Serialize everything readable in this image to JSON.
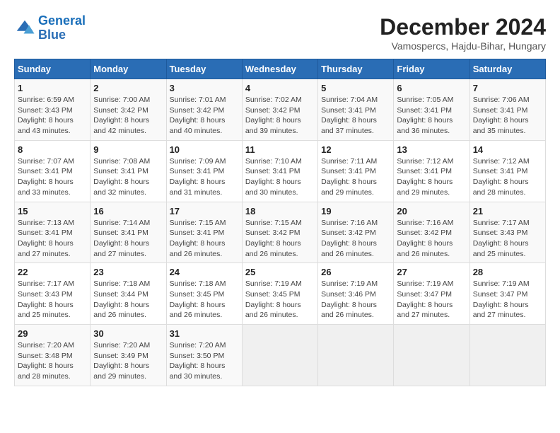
{
  "header": {
    "logo_line1": "General",
    "logo_line2": "Blue",
    "title": "December 2024",
    "subtitle": "Vamospercs, Hajdu-Bihar, Hungary"
  },
  "days_of_week": [
    "Sunday",
    "Monday",
    "Tuesday",
    "Wednesday",
    "Thursday",
    "Friday",
    "Saturday"
  ],
  "weeks": [
    [
      {
        "day": "1",
        "sunrise": "6:59 AM",
        "sunset": "3:43 PM",
        "daylight": "8 hours and 43 minutes."
      },
      {
        "day": "2",
        "sunrise": "7:00 AM",
        "sunset": "3:42 PM",
        "daylight": "8 hours and 42 minutes."
      },
      {
        "day": "3",
        "sunrise": "7:01 AM",
        "sunset": "3:42 PM",
        "daylight": "8 hours and 40 minutes."
      },
      {
        "day": "4",
        "sunrise": "7:02 AM",
        "sunset": "3:42 PM",
        "daylight": "8 hours and 39 minutes."
      },
      {
        "day": "5",
        "sunrise": "7:04 AM",
        "sunset": "3:41 PM",
        "daylight": "8 hours and 37 minutes."
      },
      {
        "day": "6",
        "sunrise": "7:05 AM",
        "sunset": "3:41 PM",
        "daylight": "8 hours and 36 minutes."
      },
      {
        "day": "7",
        "sunrise": "7:06 AM",
        "sunset": "3:41 PM",
        "daylight": "8 hours and 35 minutes."
      }
    ],
    [
      {
        "day": "8",
        "sunrise": "7:07 AM",
        "sunset": "3:41 PM",
        "daylight": "8 hours and 33 minutes."
      },
      {
        "day": "9",
        "sunrise": "7:08 AM",
        "sunset": "3:41 PM",
        "daylight": "8 hours and 32 minutes."
      },
      {
        "day": "10",
        "sunrise": "7:09 AM",
        "sunset": "3:41 PM",
        "daylight": "8 hours and 31 minutes."
      },
      {
        "day": "11",
        "sunrise": "7:10 AM",
        "sunset": "3:41 PM",
        "daylight": "8 hours and 30 minutes."
      },
      {
        "day": "12",
        "sunrise": "7:11 AM",
        "sunset": "3:41 PM",
        "daylight": "8 hours and 29 minutes."
      },
      {
        "day": "13",
        "sunrise": "7:12 AM",
        "sunset": "3:41 PM",
        "daylight": "8 hours and 29 minutes."
      },
      {
        "day": "14",
        "sunrise": "7:12 AM",
        "sunset": "3:41 PM",
        "daylight": "8 hours and 28 minutes."
      }
    ],
    [
      {
        "day": "15",
        "sunrise": "7:13 AM",
        "sunset": "3:41 PM",
        "daylight": "8 hours and 27 minutes."
      },
      {
        "day": "16",
        "sunrise": "7:14 AM",
        "sunset": "3:41 PM",
        "daylight": "8 hours and 27 minutes."
      },
      {
        "day": "17",
        "sunrise": "7:15 AM",
        "sunset": "3:41 PM",
        "daylight": "8 hours and 26 minutes."
      },
      {
        "day": "18",
        "sunrise": "7:15 AM",
        "sunset": "3:42 PM",
        "daylight": "8 hours and 26 minutes."
      },
      {
        "day": "19",
        "sunrise": "7:16 AM",
        "sunset": "3:42 PM",
        "daylight": "8 hours and 26 minutes."
      },
      {
        "day": "20",
        "sunrise": "7:16 AM",
        "sunset": "3:42 PM",
        "daylight": "8 hours and 26 minutes."
      },
      {
        "day": "21",
        "sunrise": "7:17 AM",
        "sunset": "3:43 PM",
        "daylight": "8 hours and 25 minutes."
      }
    ],
    [
      {
        "day": "22",
        "sunrise": "7:17 AM",
        "sunset": "3:43 PM",
        "daylight": "8 hours and 25 minutes."
      },
      {
        "day": "23",
        "sunrise": "7:18 AM",
        "sunset": "3:44 PM",
        "daylight": "8 hours and 26 minutes."
      },
      {
        "day": "24",
        "sunrise": "7:18 AM",
        "sunset": "3:45 PM",
        "daylight": "8 hours and 26 minutes."
      },
      {
        "day": "25",
        "sunrise": "7:19 AM",
        "sunset": "3:45 PM",
        "daylight": "8 hours and 26 minutes."
      },
      {
        "day": "26",
        "sunrise": "7:19 AM",
        "sunset": "3:46 PM",
        "daylight": "8 hours and 26 minutes."
      },
      {
        "day": "27",
        "sunrise": "7:19 AM",
        "sunset": "3:47 PM",
        "daylight": "8 hours and 27 minutes."
      },
      {
        "day": "28",
        "sunrise": "7:19 AM",
        "sunset": "3:47 PM",
        "daylight": "8 hours and 27 minutes."
      }
    ],
    [
      {
        "day": "29",
        "sunrise": "7:20 AM",
        "sunset": "3:48 PM",
        "daylight": "8 hours and 28 minutes."
      },
      {
        "day": "30",
        "sunrise": "7:20 AM",
        "sunset": "3:49 PM",
        "daylight": "8 hours and 29 minutes."
      },
      {
        "day": "31",
        "sunrise": "7:20 AM",
        "sunset": "3:50 PM",
        "daylight": "8 hours and 30 minutes."
      },
      null,
      null,
      null,
      null
    ]
  ],
  "labels": {
    "sunrise": "Sunrise:",
    "sunset": "Sunset:",
    "daylight": "Daylight:"
  }
}
